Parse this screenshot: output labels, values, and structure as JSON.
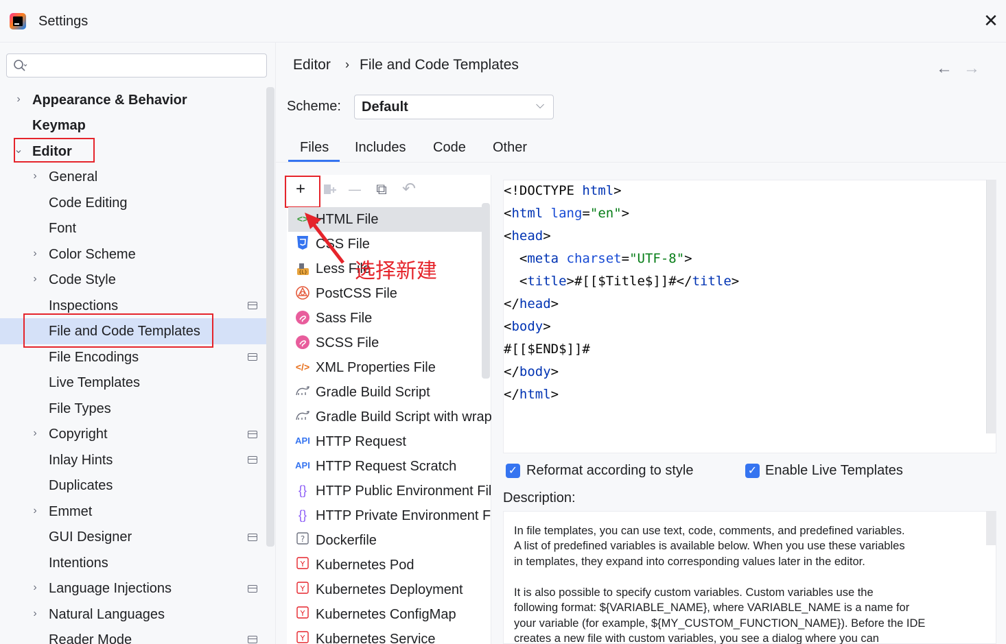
{
  "window": {
    "title": "Settings"
  },
  "search": {
    "placeholder": ""
  },
  "sidebar": {
    "items": [
      {
        "label": "Appearance & Behavior"
      },
      {
        "label": "Keymap"
      },
      {
        "label": "Editor"
      },
      {
        "label": "General"
      },
      {
        "label": "Code Editing"
      },
      {
        "label": "Font"
      },
      {
        "label": "Color Scheme"
      },
      {
        "label": "Code Style"
      },
      {
        "label": "Inspections"
      },
      {
        "label": "File and Code Templates"
      },
      {
        "label": "File Encodings"
      },
      {
        "label": "Live Templates"
      },
      {
        "label": "File Types"
      },
      {
        "label": "Copyright"
      },
      {
        "label": "Inlay Hints"
      },
      {
        "label": "Duplicates"
      },
      {
        "label": "Emmet"
      },
      {
        "label": "GUI Designer"
      },
      {
        "label": "Intentions"
      },
      {
        "label": "Language Injections"
      },
      {
        "label": "Natural Languages"
      },
      {
        "label": "Reader Mode"
      }
    ]
  },
  "breadcrumb": {
    "parent": "Editor",
    "separator": "›",
    "current": "File and Code Templates"
  },
  "nav": {
    "back": "←",
    "forward": "→"
  },
  "scheme": {
    "label": "Scheme:",
    "value": "Default"
  },
  "tabs": [
    {
      "label": "Files"
    },
    {
      "label": "Includes"
    },
    {
      "label": "Code"
    },
    {
      "label": "Other"
    }
  ],
  "toolbar": {
    "add": "+",
    "remove": "—",
    "copy": "⧉",
    "reset": "↶"
  },
  "files": [
    {
      "label": "HTML File",
      "icon": "html-icon"
    },
    {
      "label": "CSS File",
      "icon": "css-icon"
    },
    {
      "label": "Less File",
      "icon": "less-icon"
    },
    {
      "label": "PostCSS File",
      "icon": "postcss-icon"
    },
    {
      "label": "Sass File",
      "icon": "sass-icon"
    },
    {
      "label": "SCSS File",
      "icon": "scss-icon"
    },
    {
      "label": "XML Properties File",
      "icon": "xml-icon"
    },
    {
      "label": "Gradle Build Script",
      "icon": "gradle-icon"
    },
    {
      "label": "Gradle Build Script with wrapper",
      "icon": "gradle-icon"
    },
    {
      "label": "HTTP Request",
      "icon": "api-icon"
    },
    {
      "label": "HTTP Request Scratch",
      "icon": "api-icon"
    },
    {
      "label": "HTTP Public Environment File",
      "icon": "braces-icon"
    },
    {
      "label": "HTTP Private Environment File",
      "icon": "braces-icon"
    },
    {
      "label": "Dockerfile",
      "icon": "dockerfile-icon"
    },
    {
      "label": "Kubernetes Pod",
      "icon": "kubernetes-icon"
    },
    {
      "label": "Kubernetes Deployment",
      "icon": "kubernetes-icon"
    },
    {
      "label": "Kubernetes ConfigMap",
      "icon": "kubernetes-icon"
    },
    {
      "label": "Kubernetes Service",
      "icon": "kubernetes-icon"
    }
  ],
  "annotation": {
    "text": "选择新建"
  },
  "code": {
    "l1a": "<!DOCTYPE ",
    "l1b": "html",
    "l1c": ">",
    "l2a": "<",
    "l2b": "html",
    "l2c": " lang",
    "l2d": "=",
    "l2e": "\"en\"",
    "l2f": ">",
    "l3a": "<",
    "l3b": "head",
    "l3c": ">",
    "l4a": "  <",
    "l4b": "meta",
    "l4c": " charset",
    "l4d": "=",
    "l4e": "\"UTF-8\"",
    "l4f": ">",
    "l5a": "  <",
    "l5b": "title",
    "l5c": ">#[[$Title$]]#</",
    "l5d": "title",
    "l5e": ">",
    "l6a": "</",
    "l6b": "head",
    "l6c": ">",
    "l7a": "<",
    "l7b": "body",
    "l7c": ">",
    "l8": "#[[$END$]]#",
    "l9a": "</",
    "l9b": "body",
    "l9c": ">",
    "l10a": "</",
    "l10b": "html",
    "l10c": ">"
  },
  "options": {
    "reformat": "Reformat according to style",
    "live_templates": "Enable Live Templates",
    "reformat_checked": true,
    "live_checked": true
  },
  "description": {
    "label": "Description:",
    "lines": [
      "In file templates, you can use text, code, comments, and predefined variables.",
      "A list of predefined variables is available below. When you use these variables",
      "in templates, they expand into corresponding values later in the editor.",
      "",
      "It is also possible to specify custom variables. Custom variables use the",
      "following format: ${VARIABLE_NAME}, where VARIABLE_NAME is a name for",
      "your variable (for example, ${MY_CUSTOM_FUNCTION_NAME}). Before the IDE",
      "creates a new file with custom variables, you see a dialog where you can"
    ]
  },
  "colors": {
    "accent": "#3574f0",
    "highlight_box": "#e5242b",
    "selection": "#d5e1f8"
  }
}
